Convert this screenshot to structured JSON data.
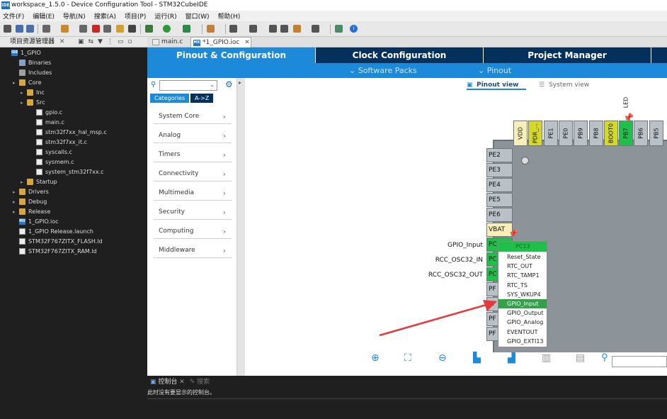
{
  "window": {
    "title": "workspace_1.5.0 - Device Configuration Tool - STM32CubeIDE",
    "app_icon_label": "IDE"
  },
  "menubar": [
    "文件(F)",
    "编辑(E)",
    "导航(N)",
    "搜索(A)",
    "项目(P)",
    "运行(R)",
    "窗口(W)",
    "帮助(H)"
  ],
  "project_explorer": {
    "title": "项目资源管理器",
    "tree": [
      {
        "label": "1_GPIO",
        "icon": "ide-project-icon",
        "level": 0
      },
      {
        "label": "Binaries",
        "icon": "binaries-icon",
        "level": 1
      },
      {
        "label": "Includes",
        "icon": "includes-icon",
        "level": 1
      },
      {
        "label": "Core",
        "icon": "folder-icon",
        "level": 1
      },
      {
        "label": "Inc",
        "icon": "folder-icon",
        "level": 2
      },
      {
        "label": "Src",
        "icon": "folder-icon",
        "level": 2
      },
      {
        "label": "gpio.c",
        "icon": "c-file-icon",
        "level": 3
      },
      {
        "label": "main.c",
        "icon": "c-file-icon",
        "level": 3
      },
      {
        "label": "stm32f7xx_hal_msp.c",
        "icon": "c-file-icon",
        "level": 3
      },
      {
        "label": "stm32f7xx_it.c",
        "icon": "c-file-icon",
        "level": 3
      },
      {
        "label": "syscalls.c",
        "icon": "c-file-icon",
        "level": 3
      },
      {
        "label": "sysmem.c",
        "icon": "c-file-icon",
        "level": 3
      },
      {
        "label": "system_stm32f7xx.c",
        "icon": "c-file-icon",
        "level": 3
      },
      {
        "label": "Startup",
        "icon": "folder-icon",
        "level": 2
      },
      {
        "label": "Drivers",
        "icon": "folder-icon",
        "level": 1
      },
      {
        "label": "Debug",
        "icon": "folder-icon",
        "level": 1
      },
      {
        "label": "Release",
        "icon": "folder-icon",
        "level": 1
      },
      {
        "label": "1_GPIO.ioc",
        "icon": "mx-file-icon",
        "level": 1
      },
      {
        "label": "1_GPIO Release.launch",
        "icon": "launch-file-icon",
        "level": 1
      },
      {
        "label": "STM32F767ZITX_FLASH.ld",
        "icon": "ld-file-icon",
        "level": 1
      },
      {
        "label": "STM32F767ZITX_RAM.ld",
        "icon": "ld-file-icon",
        "level": 1
      }
    ]
  },
  "editor_tabs": [
    {
      "label": "main.c",
      "icon": "c-file-icon",
      "active": false
    },
    {
      "label": "*1_GPIO.ioc",
      "icon": "mx-file-icon",
      "active": true
    }
  ],
  "main_tabs": [
    {
      "label": "Pinout & Configuration",
      "active": true
    },
    {
      "label": "Clock Configuration",
      "active": false
    },
    {
      "label": "Project Manager",
      "active": false
    }
  ],
  "sub_bar": {
    "software_packs": "Software Packs",
    "pinout": "Pinout"
  },
  "categories": {
    "tab_categories": "Categories",
    "tab_az": "A->Z",
    "items": [
      "System Core",
      "Analog",
      "Timers",
      "Connectivity",
      "Multimedia",
      "Security",
      "Computing",
      "Middleware"
    ]
  },
  "view_buttons": {
    "pinout_view": "Pinout view",
    "system_view": "System view"
  },
  "chip": {
    "top_pins": [
      {
        "label": "VDD",
        "color": "#f7eeb8"
      },
      {
        "label": "PDR_...",
        "color": "#d4d82a"
      },
      {
        "label": "PE1",
        "color": "#b9c1c7"
      },
      {
        "label": "PE0",
        "color": "#b9c1c7"
      },
      {
        "label": "PB9",
        "color": "#b9c1c7"
      },
      {
        "label": "PB8",
        "color": "#b9c1c7"
      },
      {
        "label": "BOOT0",
        "color": "#d4d82a"
      },
      {
        "label": "PB7",
        "color": "#1ec04a"
      },
      {
        "label": "PB6",
        "color": "#b9c1c7"
      },
      {
        "label": "PB5",
        "color": "#b9c1c7"
      }
    ],
    "led_label": "LED",
    "left_pins": [
      {
        "label": "PE2",
        "color": "#b9c1c7"
      },
      {
        "label": "PE3",
        "color": "#b9c1c7"
      },
      {
        "label": "PE4",
        "color": "#b9c1c7"
      },
      {
        "label": "PE5",
        "color": "#b9c1c7"
      },
      {
        "label": "PE6",
        "color": "#b9c1c7"
      },
      {
        "label": "VBAT",
        "color": "#f7eeb8"
      },
      {
        "label": "PC",
        "color": "#1ec04a"
      },
      {
        "label": "PC",
        "color": "#1ec04a"
      },
      {
        "label": "PC",
        "color": "#1ec04a"
      },
      {
        "label": "PF",
        "color": "#b9c1c7"
      },
      {
        "label": "PF",
        "color": "#b9c1c7"
      },
      {
        "label": "PF",
        "color": "#b9c1c7"
      },
      {
        "label": "PF",
        "color": "#b9c1c7"
      }
    ],
    "signals": [
      "GPIO_Input",
      "RCC_OSC32_IN",
      "RCC_OSC32_OUT"
    ]
  },
  "pin_popup": {
    "title": "PC13",
    "options": [
      "Reset_State",
      "RTC_OUT",
      "RTC_TAMP1",
      "RTC_TS",
      "SYS_WKUP4",
      "GPIO_Input",
      "GPIO_Output",
      "GPIO_Analog",
      "EVENTOUT",
      "GPIO_EXTI13"
    ],
    "selected": "GPIO_Input"
  },
  "console": {
    "title": "控制台",
    "tab2": "搜索",
    "message": "此时没有要显示的控制台。"
  },
  "colors": {
    "accent": "#1c8ad8",
    "tab_dark": "#04315c",
    "pin_green": "#1ec04a",
    "arrow": "#e53a3a"
  }
}
